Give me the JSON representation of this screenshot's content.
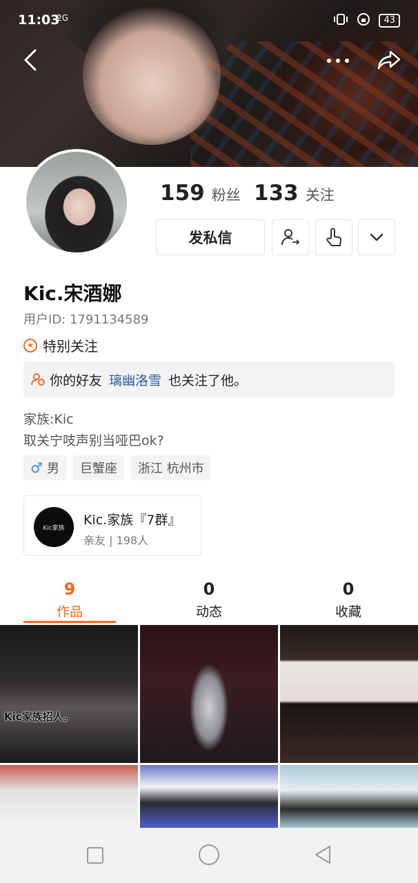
{
  "status_bar": {
    "time": "11:03",
    "network": "2G",
    "battery": "43"
  },
  "header": {
    "back_icon": "chevron-left-icon",
    "more_icon": "more-horizontal-icon",
    "share_icon": "share-arrow-icon"
  },
  "profile": {
    "fans_count": "159",
    "fans_label": "粉丝",
    "following_count": "133",
    "following_label": "关注",
    "message_button": "发私信",
    "name": "Kic.宋酒娜",
    "user_id": "用户ID: 1791134589",
    "special_follow": "特别关注",
    "friend_prefix": "你的好友",
    "friend_name": "璃幽洛雪",
    "friend_suffix": "也关注了他。",
    "bio_line1": "家族:Kic",
    "bio_line2": "取关宁吱声别当哑巴ok?",
    "tags": {
      "gender_symbol": "♂",
      "gender": "男",
      "zodiac": "巨蟹座",
      "location": "浙江 杭州市"
    }
  },
  "group": {
    "name": "Kic.家族『7群』",
    "meta": "亲友 | 198人",
    "logo_text": "Kic家族"
  },
  "tabs": [
    {
      "count": "9",
      "label": "作品"
    },
    {
      "count": "0",
      "label": "动态"
    },
    {
      "count": "0",
      "label": "收藏"
    }
  ],
  "grid": {
    "cell1_caption": "Kic家族招人。"
  },
  "colors": {
    "accent": "#f06a1f",
    "link": "#2a5d9a",
    "male": "#3f8be0"
  }
}
